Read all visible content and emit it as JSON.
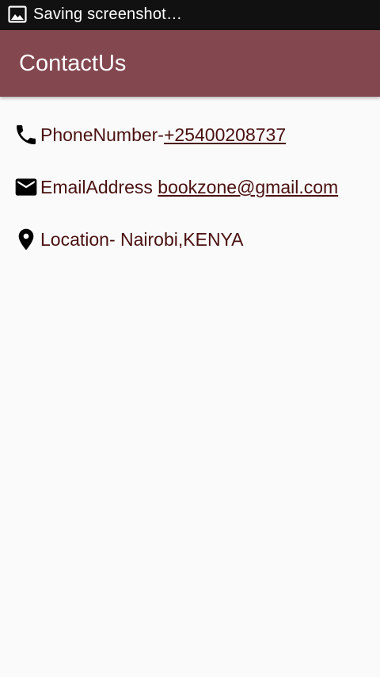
{
  "status_bar": {
    "notification_icon": "image-icon",
    "text": "Saving screenshot…"
  },
  "app_bar": {
    "title": "ContactUs",
    "color": "#834750"
  },
  "contacts": {
    "phone": {
      "icon": "phone-icon",
      "label": "PhoneNumber-",
      "value": "+25400208737"
    },
    "email": {
      "icon": "mail-icon",
      "label": "EmailAddress ",
      "value": "bookzone@gmail.com"
    },
    "location": {
      "icon": "location-pin-icon",
      "label": "Location- Nairobi,KENYA"
    }
  },
  "text_color": "#4a1010"
}
